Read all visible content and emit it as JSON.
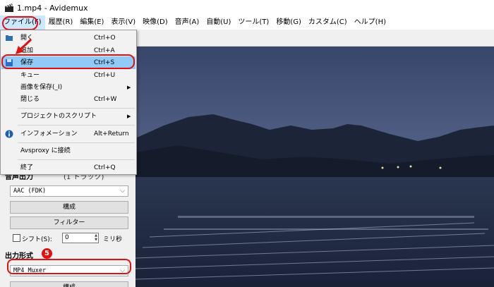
{
  "window": {
    "title": "1.mp4 - Avidemux"
  },
  "menubar": [
    "ファイル(F)",
    "履歴(R)",
    "編集(E)",
    "表示(V)",
    "映像(D)",
    "音声(A)",
    "自動(U)",
    "ツール(T)",
    "移動(G)",
    "カスタム(C)",
    "ヘルプ(H)"
  ],
  "file_menu": {
    "items": [
      {
        "label": "開く",
        "shortcut": "Ctrl+O"
      },
      {
        "label": "追加",
        "shortcut": "Ctrl+A"
      },
      {
        "label": "保存",
        "shortcut": "Ctrl+S"
      },
      {
        "label": "キュー",
        "shortcut": "Ctrl+U"
      },
      {
        "label": "画像を保存(_I)",
        "shortcut": ""
      },
      {
        "label": "閉じる",
        "shortcut": "Ctrl+W"
      },
      {
        "label": "プロジェクトのスクリプト",
        "shortcut": ""
      },
      {
        "label": "インフォメーション",
        "shortcut": "Alt+Return"
      },
      {
        "label": "Avsproxy に接続",
        "shortcut": ""
      },
      {
        "label": "終了",
        "shortcut": "Ctrl+Q"
      }
    ]
  },
  "left_panel": {
    "audio_section_label": "音声出力",
    "audio_track_info": "(1 トラック)",
    "audio_codec": "AAC (FDK)",
    "configure_label": "構成",
    "filter_label": "フィルター",
    "shift_label": "シフト(S):",
    "shift_value": "0",
    "shift_unit": "ミリ秒",
    "output_format_label": "出力形式",
    "output_format": "MP4 Muxer",
    "configure2_label": "構成"
  },
  "annotations": {
    "step_file_menu": "6",
    "step_output_format": "5"
  },
  "colors": {
    "highlight": "#91c9f7",
    "annotation_red": "#e01010"
  }
}
